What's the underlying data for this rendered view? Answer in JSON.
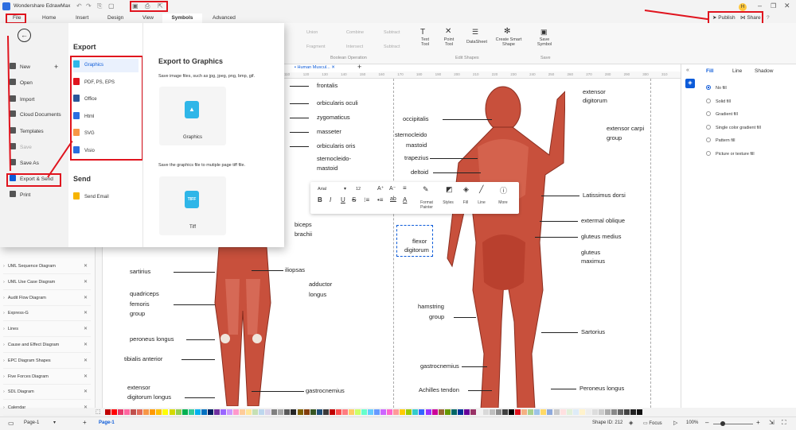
{
  "app": {
    "title": "Wondershare EdrawMax",
    "user_initial": "H"
  },
  "menubar": {
    "items": [
      "File",
      "Home",
      "Insert",
      "Design",
      "View",
      "Symbols",
      "Advanced"
    ],
    "active": "Symbols",
    "publish": "Publish",
    "share": "Share"
  },
  "ribbon": {
    "boolean_group": {
      "label": "Boolean Operation",
      "buttons": [
        "Union",
        "Combine",
        "Subtract",
        "Fragment",
        "Intersect",
        "Subtract"
      ]
    },
    "edit_shapes": {
      "label": "Edit Shapes",
      "buttons": [
        "Text Tool",
        "Point Tool",
        "DataSheet",
        "Create Smart Shape"
      ]
    },
    "save_group": {
      "label": "Save",
      "buttons": [
        "Save Symbol"
      ]
    }
  },
  "file_menu": {
    "nav": [
      "New",
      "Open",
      "Import",
      "Cloud Documents",
      "Templates",
      "Save",
      "Save As",
      "Export & Send",
      "Print"
    ],
    "export_heading": "Export",
    "export_items": [
      "Graphics",
      "PDF, PS, EPS",
      "Office",
      "Html",
      "SVG",
      "Visio"
    ],
    "send_heading": "Send",
    "send_items": [
      "Send Email"
    ],
    "panel_title": "Export to Graphics",
    "panel_desc": "Save image files, such as jpg, jpeg, png, bmp, gif.",
    "card1": "Graphics",
    "tiff_desc": "Save the graphics file to mutiple page tiff file.",
    "card2": "Tiff",
    "tiff_icon_text": "TIFF"
  },
  "libraries": [
    "UML Sequence Diagram",
    "UML Use Case Diagram",
    "Audit Flow Diagram",
    "Express-G",
    "Lines",
    "Cause and Effect Diagram",
    "EPC Diagram Shapes",
    "Five Forces Diagram",
    "SDL Diagram",
    "Calendar"
  ],
  "doc_tab": "Human Muscul...",
  "ruler_ticks": [
    "110",
    "120",
    "130",
    "140",
    "150",
    "160",
    "170",
    "180",
    "190",
    "200",
    "210",
    "220",
    "230",
    "240",
    "250",
    "260",
    "270",
    "280",
    "290",
    "300",
    "310",
    "320",
    "330",
    "340",
    "350",
    "360"
  ],
  "format_bar": {
    "font": "Arial",
    "size": "12",
    "buttons": [
      "Format Painter",
      "Styles",
      "Fill",
      "Line",
      "More"
    ]
  },
  "labels_left": [
    "frontalis",
    "orbicularis oculi",
    "zygomaticus",
    "masseter",
    "orbicularis oris",
    "sternocleido-",
    "mastoid",
    "biceps",
    "brachii",
    "sartirius",
    "iliopsas",
    "adductor",
    "longus",
    "quadriceps",
    "femoris",
    "group",
    "peroneus longus",
    "tibialis anterior",
    "extensor",
    "digitorum longus",
    "gastrocnemius"
  ],
  "labels_right": [
    "extensor",
    "digitorum",
    "occipitalis",
    "extensor carpi",
    "group",
    "sternocleido",
    "mastoid",
    "trapezius",
    "deltoid",
    "Latissimus dorsi",
    "extermal oblique",
    "gluteus medius",
    "flexor",
    "digitorum",
    "gluteus",
    "maximus",
    "hamstring",
    "group",
    "Sartorius",
    "gastrocnemius",
    "Achilles tendon",
    "Peroneus longus"
  ],
  "right_panel": {
    "tabs": [
      "Fill",
      "Line",
      "Shadow"
    ],
    "options": [
      "No fill",
      "Solid fill",
      "Gradient fill",
      "Single color gradient fill",
      "Pattern fill",
      "Picture or texture fill"
    ]
  },
  "statusbar": {
    "page_selector": "Page-1",
    "page_tab": "Page-1",
    "shape_id": "Shape ID: 212",
    "focus": "Focus",
    "zoom": "100%"
  },
  "colors": {
    "accent": "#0c5bd9",
    "red_annotation": "#e0141e",
    "muscle": "#c8503c"
  },
  "palette": [
    "#c00000",
    "#ff0000",
    "#e7386b",
    "#ff66a0",
    "#c0504d",
    "#e26b5b",
    "#f79646",
    "#ff9900",
    "#ffc000",
    "#ffff00",
    "#d4d900",
    "#92d050",
    "#00b050",
    "#33cc99",
    "#00b0f0",
    "#0070c0",
    "#002060",
    "#7030a0",
    "#9966ff",
    "#cc99ff",
    "#ff99cc",
    "#ffcc99",
    "#ffe699",
    "#c6e0b4",
    "#bdd7ee",
    "#d9d2e9",
    "#808080",
    "#a6a6a6",
    "#595959",
    "#262626",
    "#7f6000",
    "#833c0b",
    "#375623",
    "#1f4e78",
    "#3a3838",
    "#c00000",
    "#ff5050",
    "#ff7c80",
    "#ffcc66",
    "#ccff66",
    "#66ffcc",
    "#66ccff",
    "#6699ff",
    "#cc66ff",
    "#ff66cc",
    "#ff9999",
    "#ffcc00",
    "#99cc00",
    "#33cccc",
    "#3366ff",
    "#9933ff",
    "#cc0099",
    "#996633",
    "#669900",
    "#006666",
    "#003399",
    "#660099",
    "#993366",
    "#f2f2f2",
    "#d9d9d9",
    "#bfbfbf",
    "#8c8c8c",
    "#404040",
    "#000000",
    "#e0141e",
    "#f4b183",
    "#a9d18e",
    "#9dc3e6",
    "#ffd966",
    "#8faadc",
    "#c9c9c9",
    "#ffe0e0",
    "#e2f0d9",
    "#deebf7",
    "#fff2cc",
    "#ededed",
    "#dddddd",
    "#cccccc",
    "#aaaaaa",
    "#888888",
    "#666666",
    "#444444",
    "#222222",
    "#111111"
  ]
}
